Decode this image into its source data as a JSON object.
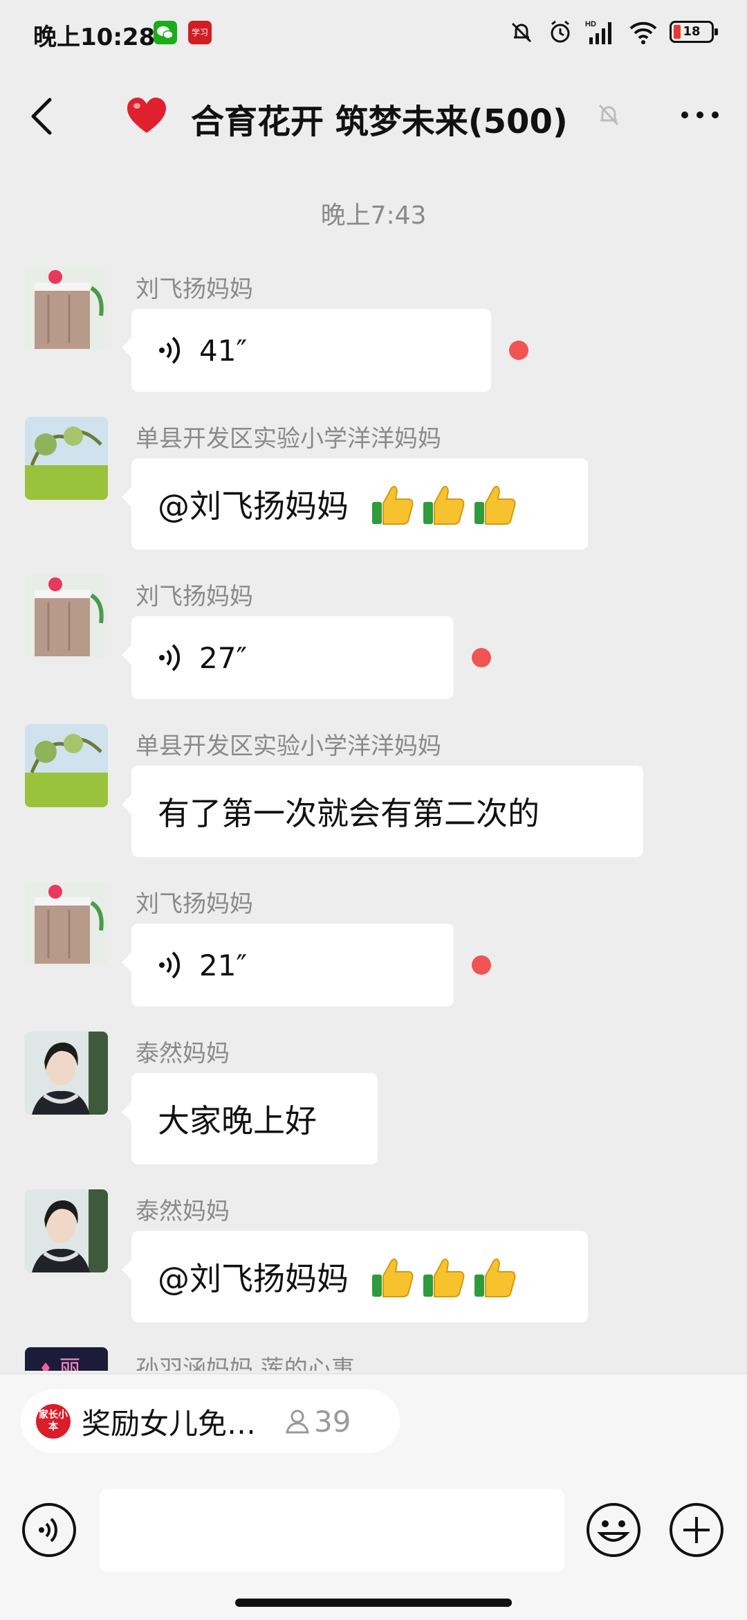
{
  "status": {
    "time": "晚上10:28",
    "battery": "18",
    "study_app": "学习"
  },
  "header": {
    "title": "合育花开 筑梦未来(500)"
  },
  "chat": {
    "timestamp": "晚上7:43",
    "messages": [
      {
        "sender": "刘飞扬妈妈",
        "kind": "voice",
        "duration": "41″"
      },
      {
        "sender": "单县开发区实验小学洋洋妈妈",
        "kind": "text",
        "text": "@刘飞扬妈妈"
      },
      {
        "sender": "刘飞扬妈妈",
        "kind": "voice",
        "duration": "27″"
      },
      {
        "sender": "单县开发区实验小学洋洋妈妈",
        "kind": "text",
        "text": "有了第一次就会有第二次的"
      },
      {
        "sender": "刘飞扬妈妈",
        "kind": "voice",
        "duration": "21″"
      },
      {
        "sender": "泰然妈妈",
        "kind": "text",
        "text": "大家晚上好"
      },
      {
        "sender": "泰然妈妈",
        "kind": "text",
        "text": "@刘飞扬妈妈"
      },
      {
        "sender": "孙羽涵妈妈 莲的心事",
        "kind": "partial"
      }
    ]
  },
  "live_chip": {
    "logo": "家长小本",
    "text": "奖励女儿免…",
    "count": "39"
  },
  "colors": {
    "background": "#ededed",
    "bubble": "#ffffff",
    "unread_dot": "#f25353",
    "muted_text": "#8a8a8a"
  }
}
